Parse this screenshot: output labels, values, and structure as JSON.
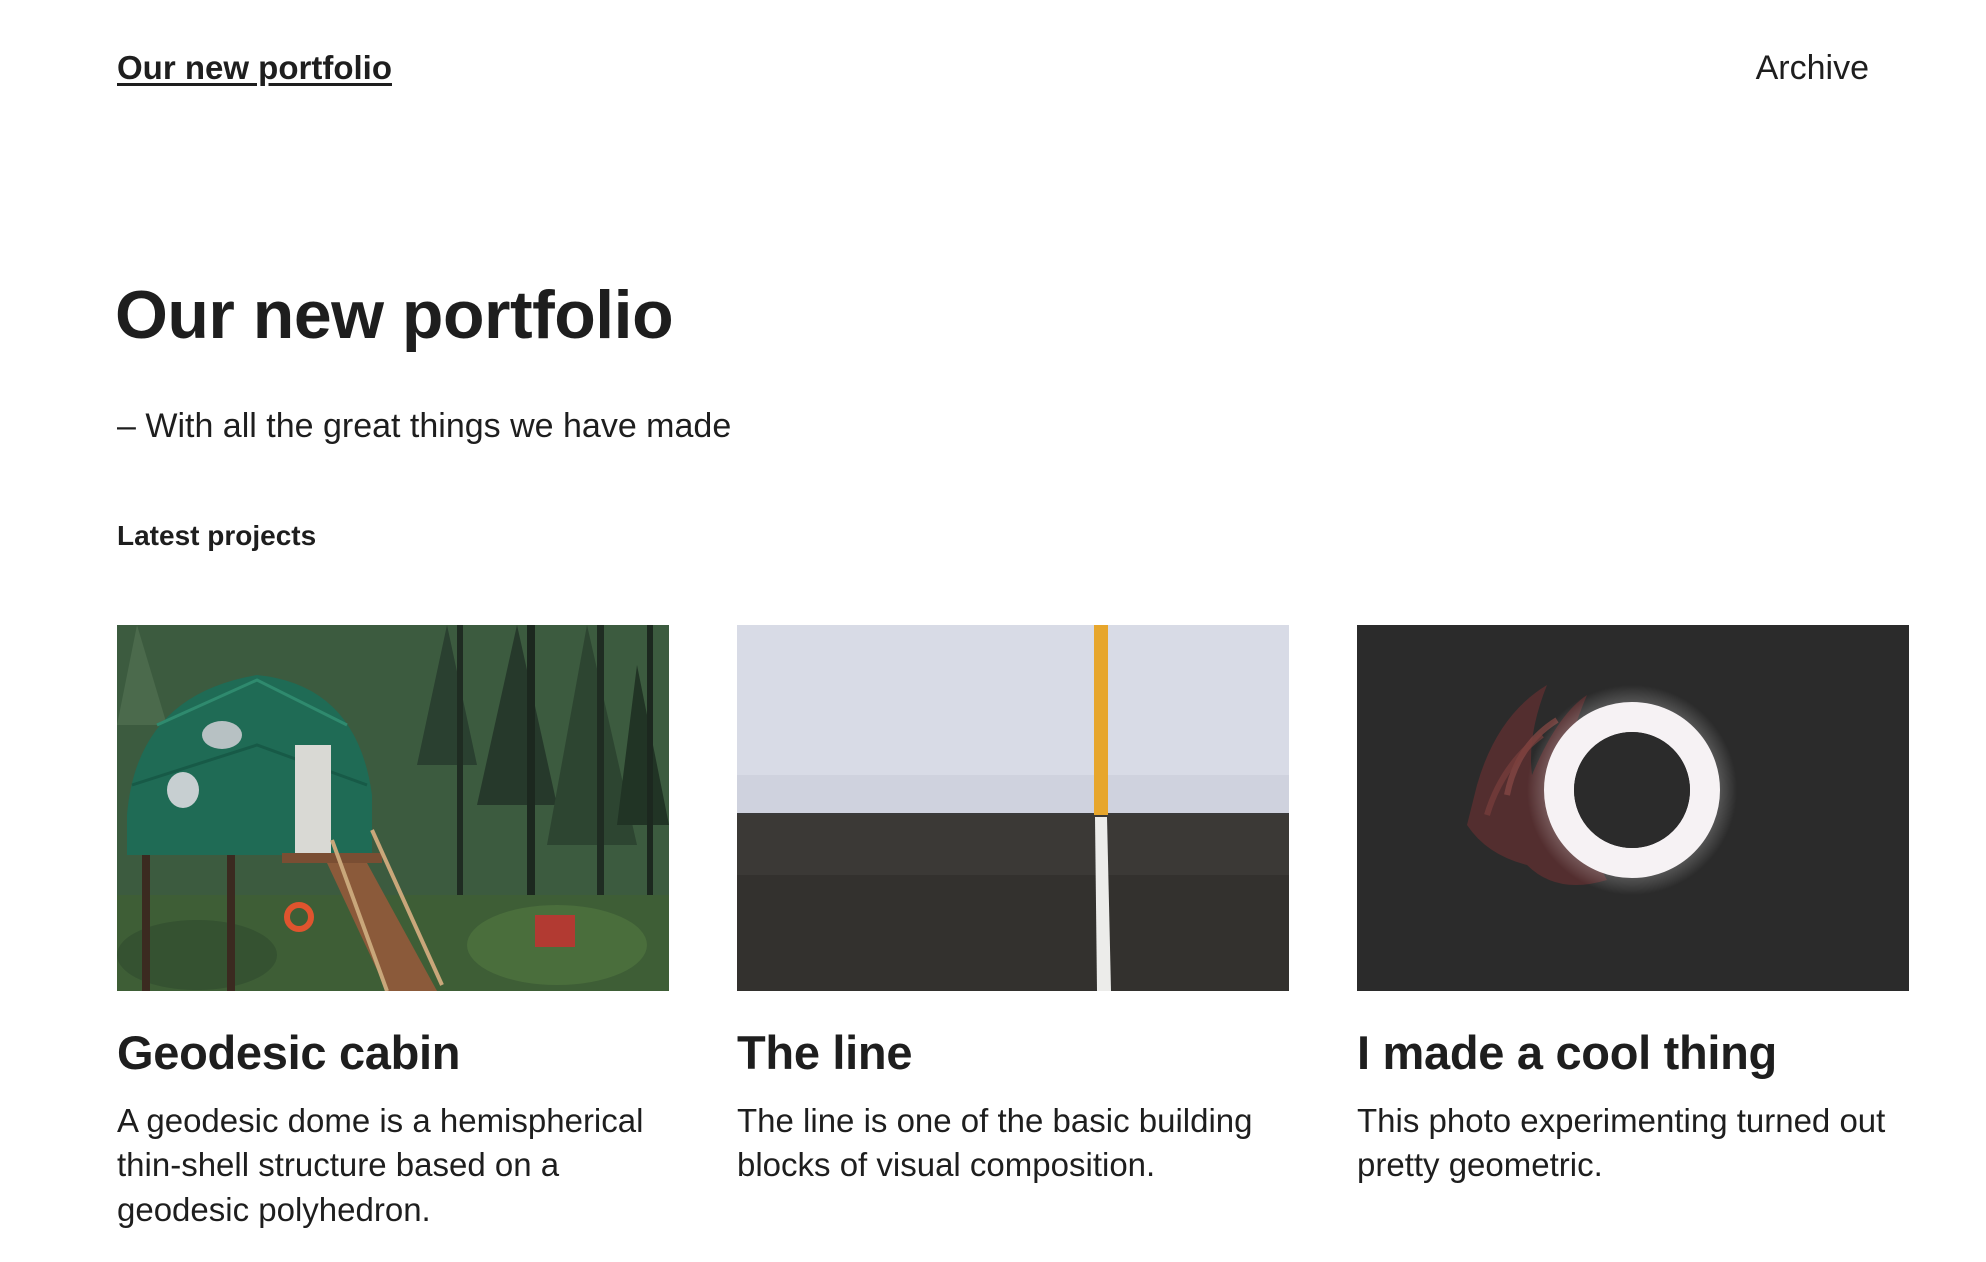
{
  "header": {
    "site_title": "Our new portfolio",
    "nav": [
      "Archive"
    ]
  },
  "hero": {
    "title": "Our new portfolio",
    "subtitle": "– With all the great things we have made"
  },
  "section": {
    "heading": "Latest projects"
  },
  "projects": [
    {
      "title": "Geodesic cabin",
      "description": "A geodesic dome is a hemispherical thin-shell structure based on a geodesic polyhedron.",
      "image": "forest-dome-tent-photo"
    },
    {
      "title": "The line",
      "description": "The line is one of the basic building blocks of visual composition.",
      "image": "wall-yellow-line-photo"
    },
    {
      "title": "I made a cool thing",
      "description": "This photo experimenting turned out pretty geometric.",
      "image": "glowing-ring-hand-photo"
    }
  ],
  "colors": {
    "text": "#1e1e1e",
    "background": "#ffffff"
  }
}
